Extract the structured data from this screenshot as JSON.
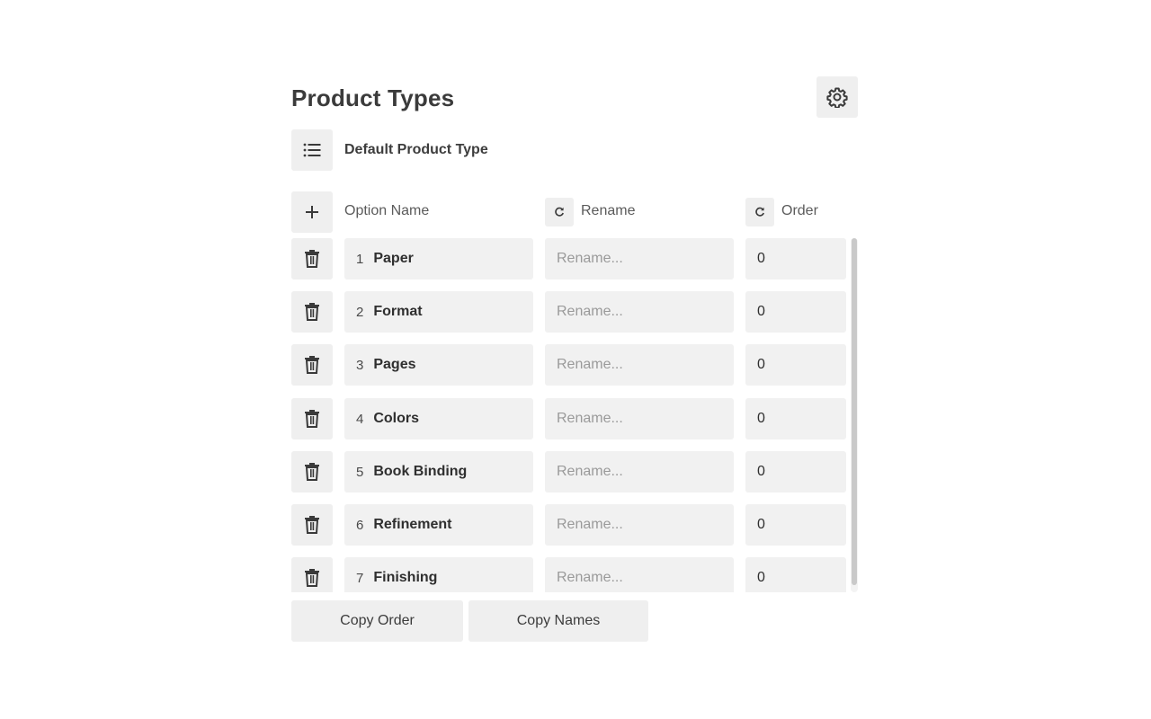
{
  "header": {
    "title": "Product Types",
    "settings_icon": "gear-icon"
  },
  "default_type": {
    "icon": "list-icon",
    "label": "Default Product Type"
  },
  "columns": {
    "add_icon": "plus-icon",
    "option_name": "Option Name",
    "rename": "Rename",
    "order": "Order",
    "reset_icon": "refresh-icon"
  },
  "rows": [
    {
      "index": "1",
      "name": "Paper",
      "rename_value": "",
      "rename_placeholder": "Rename...",
      "order": "0"
    },
    {
      "index": "2",
      "name": "Format",
      "rename_value": "",
      "rename_placeholder": "Rename...",
      "order": "0"
    },
    {
      "index": "3",
      "name": "Pages",
      "rename_value": "",
      "rename_placeholder": "Rename...",
      "order": "0"
    },
    {
      "index": "4",
      "name": "Colors",
      "rename_value": "",
      "rename_placeholder": "Rename...",
      "order": "0"
    },
    {
      "index": "5",
      "name": "Book Binding",
      "rename_value": "",
      "rename_placeholder": "Rename...",
      "order": "0"
    },
    {
      "index": "6",
      "name": "Refinement",
      "rename_value": "",
      "rename_placeholder": "Rename...",
      "order": "0"
    },
    {
      "index": "7",
      "name": "Finishing",
      "rename_value": "",
      "rename_placeholder": "Rename...",
      "order": "0"
    }
  ],
  "footer": {
    "copy_order": "Copy Order",
    "copy_names": "Copy Names"
  },
  "colors": {
    "button_bg": "#efefef",
    "field_bg": "#f1f1f1",
    "text": "#3a3a3a",
    "placeholder": "#9a9a9a"
  }
}
